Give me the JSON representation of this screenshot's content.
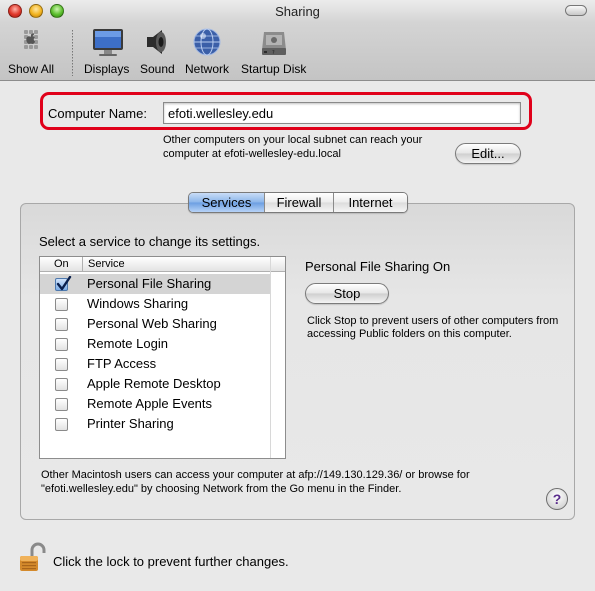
{
  "window": {
    "title": "Sharing"
  },
  "toolbar": {
    "show_all": "Show All",
    "items": [
      {
        "label": "Displays",
        "icon": "display-icon"
      },
      {
        "label": "Sound",
        "icon": "speaker-icon"
      },
      {
        "label": "Network",
        "icon": "network-globe-icon"
      },
      {
        "label": "Startup Disk",
        "icon": "hard-disk-icon"
      }
    ]
  },
  "computer_name": {
    "label": "Computer Name:",
    "value": "efoti.wellesley.edu",
    "note": "Other computers on your local subnet can reach your computer at efoti-wellesley-edu.local",
    "edit_label": "Edit..."
  },
  "tabs": [
    {
      "label": "Services",
      "active": true
    },
    {
      "label": "Firewall",
      "active": false
    },
    {
      "label": "Internet",
      "active": false
    }
  ],
  "services": {
    "prompt": "Select a service to change its settings.",
    "col_on": "On",
    "col_service": "Service",
    "items": [
      {
        "name": "Personal File Sharing",
        "on": true,
        "selected": true
      },
      {
        "name": "Windows Sharing",
        "on": false,
        "selected": false
      },
      {
        "name": "Personal Web Sharing",
        "on": false,
        "selected": false
      },
      {
        "name": "Remote Login",
        "on": false,
        "selected": false
      },
      {
        "name": "FTP Access",
        "on": false,
        "selected": false
      },
      {
        "name": "Apple Remote Desktop",
        "on": false,
        "selected": false
      },
      {
        "name": "Remote Apple Events",
        "on": false,
        "selected": false
      },
      {
        "name": "Printer Sharing",
        "on": false,
        "selected": false
      }
    ]
  },
  "status": {
    "title": "Personal File Sharing On",
    "stop_label": "Stop",
    "note": "Click Stop to prevent users of other computers from accessing Public folders on this computer."
  },
  "access_note": "Other Macintosh users can access your computer at afp://149.130.129.36/ or browse for \"efoti.wellesley.edu\" by choosing Network from the Go menu in the Finder.",
  "help": {
    "label": "?"
  },
  "lock": {
    "note": "Click the lock to prevent further changes."
  },
  "colors": {
    "highlight_frame": "#e0001a",
    "tab_active": "#8cb6ea",
    "selected_row": "#d4d4d4",
    "help_glyph": "#5a2d8c"
  }
}
